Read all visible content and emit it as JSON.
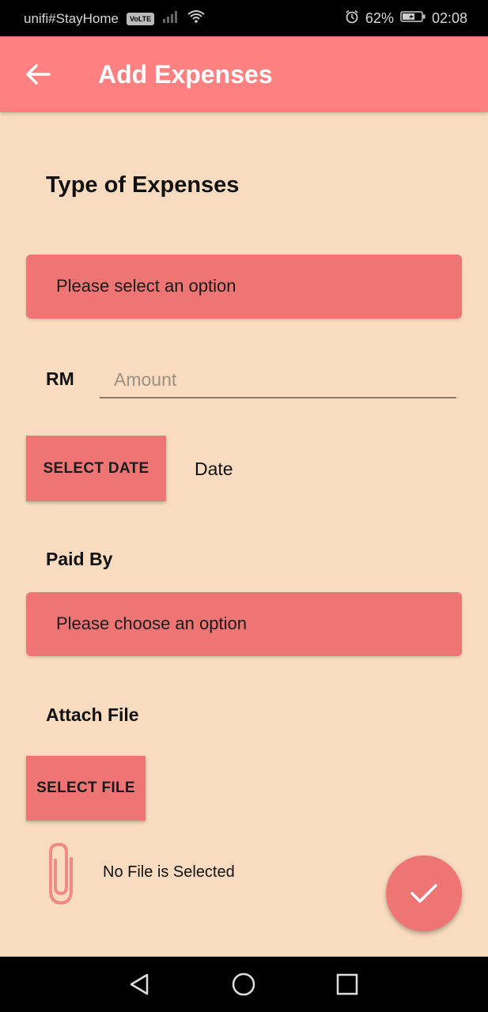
{
  "status_bar": {
    "carrier": "unifi#StayHome",
    "volte_badge": "VoLTE",
    "battery": "62%",
    "time": "02:08"
  },
  "app_bar": {
    "title": "Add Expenses",
    "back_icon": "arrow-left-icon",
    "background": "#ff8080"
  },
  "form": {
    "type_label": "Type of Expenses",
    "type_dropdown_value": "Please select an option",
    "currency_label": "RM",
    "amount_placeholder": "Amount",
    "select_date_button": "SELECT DATE",
    "date_value": "Date",
    "paid_by_label": "Paid By",
    "paid_by_dropdown_value": "Please choose an option",
    "attach_file_label": "Attach File",
    "select_file_button": "SELECT FILE",
    "file_status": "No File is Selected",
    "attachment_icon": "paperclip-icon"
  },
  "fab": {
    "icon": "check-icon"
  },
  "colors": {
    "background": "#f9dcbf",
    "accent": "#ef7575"
  }
}
